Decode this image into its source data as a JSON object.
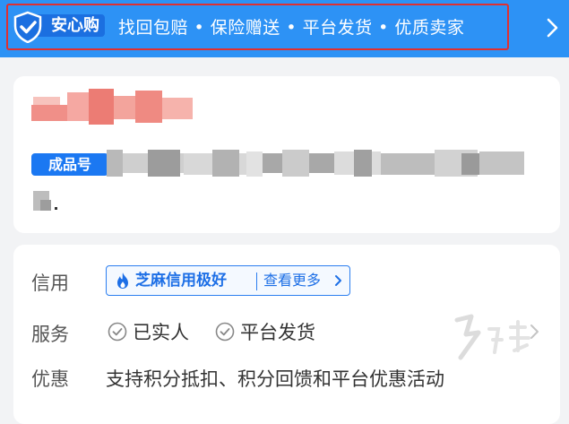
{
  "banner": {
    "badge_text": "安心购",
    "features": "找回包赔 • 保险赠送 • 平台发货 • 优质卖家",
    "color": "#2d92f5",
    "icons": [
      "shield-check-icon",
      "chevron-right-icon"
    ]
  },
  "product": {
    "sku_label": "成品号"
  },
  "info": {
    "credit": {
      "label": "信用",
      "tag_text": "芝麻信用极好",
      "more_text": "查看更多"
    },
    "service": {
      "label": "服务",
      "items": [
        "已实人",
        "平台发货"
      ]
    },
    "promo": {
      "label": "优惠",
      "text": "支持积分抵扣、积分回馈和平台优惠活动"
    }
  },
  "colors": {
    "accent": "#1b78f2",
    "highlight_border": "#e03030",
    "page_bg": "#f2f3f5"
  }
}
